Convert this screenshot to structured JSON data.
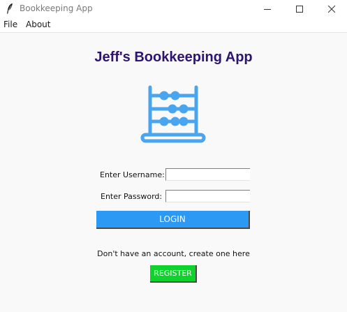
{
  "window": {
    "title": "Bookkeeping App"
  },
  "menu": {
    "items": [
      "File",
      "About"
    ]
  },
  "main": {
    "heading": "Jeff's Bookkeeping App",
    "logo_icon": "abacus-icon",
    "username_label": "Enter Username:",
    "username_value": "",
    "password_label": "Enter Password:",
    "password_value": "",
    "login_label": "LOGIN",
    "signup_text": "Don't have an account, create one here",
    "register_label": "REGISTER"
  },
  "colors": {
    "heading": "#2e1470",
    "logo": "#4aa5f0",
    "login_button": "#2c99f5",
    "register_button": "#10d22c"
  }
}
